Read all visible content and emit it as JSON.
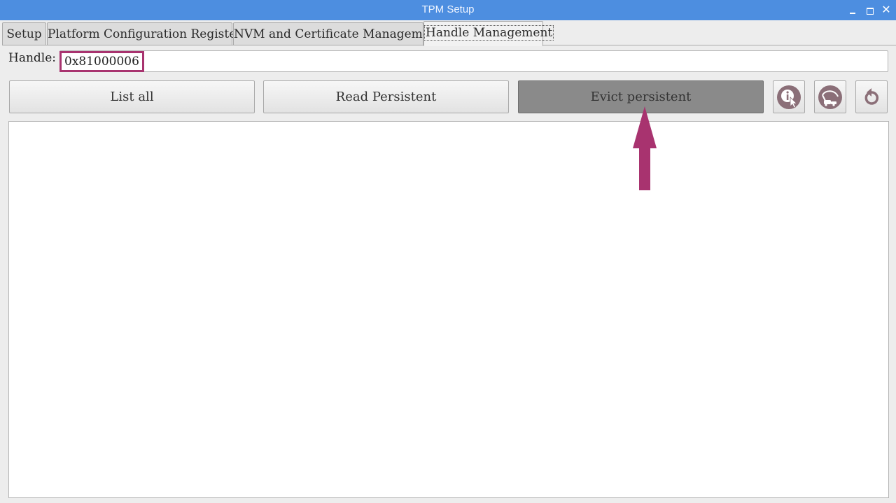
{
  "window": {
    "title": "TPM Setup"
  },
  "tabs": [
    {
      "label": "Setup"
    },
    {
      "label": "Platform Configuration Registers"
    },
    {
      "label": "NVM and Certificate Management"
    },
    {
      "label": "Handle Management"
    }
  ],
  "active_tab": "Handle Management",
  "handle": {
    "label": "Handle:",
    "value": "0x81000006"
  },
  "buttons": {
    "list_all": "List all",
    "read_persistent": "Read Persistent",
    "evict_persistent": "Evict persistent"
  },
  "icons": {
    "info": "info-pointer-icon",
    "clean": "vacuum-cleaner-icon",
    "reset": "undo-arrow-icon"
  },
  "colors": {
    "titlebar": "#4d8ee0",
    "highlight": "#a8336f",
    "pressed_button": "#8a8a8a",
    "icon_disc": "#8b6f78"
  },
  "output": {
    "text": ""
  }
}
